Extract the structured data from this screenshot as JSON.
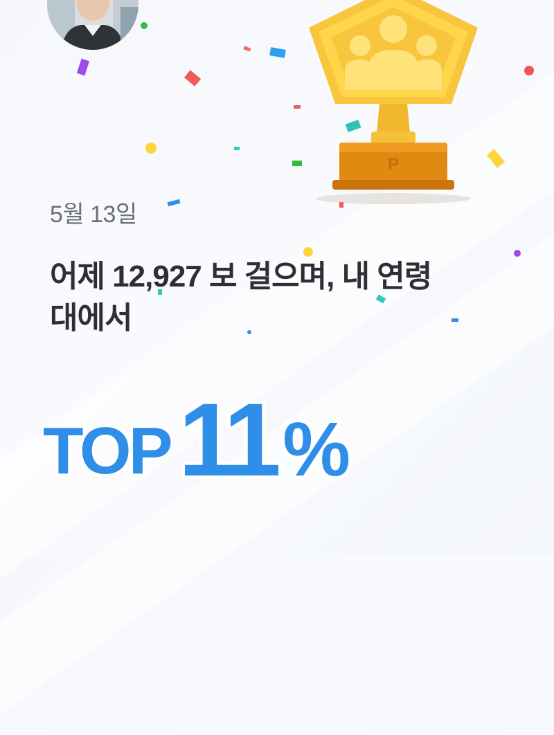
{
  "summary": {
    "date": "5월 13일",
    "headline_line1": "어제 12,927 보 걸으며, 내 연령",
    "headline_line2": "대에서",
    "rank_prefix": "TOP",
    "rank_value": "11",
    "rank_suffix": "%"
  },
  "icons": {
    "trophy": "trophy-icon",
    "avatar": "avatar-photo",
    "confetti": "confetti-decoration"
  },
  "colors": {
    "accent": "#2f8fe8",
    "trophy_gold": "#f5c13a",
    "trophy_base": "#e08a12",
    "text_primary": "#2d2f33",
    "text_secondary": "#6b6f75"
  }
}
